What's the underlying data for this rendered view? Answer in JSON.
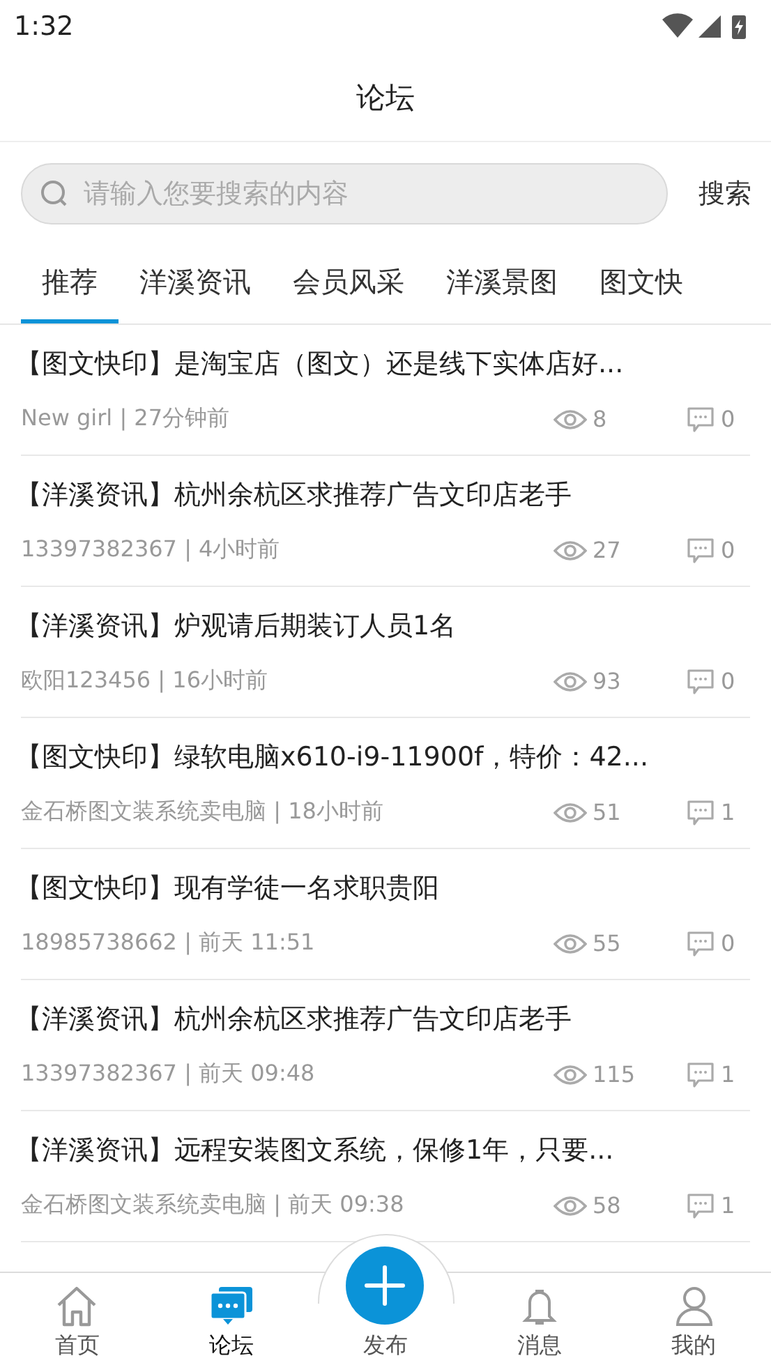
{
  "status_bar": {
    "time": "1:32"
  },
  "header": {
    "title": "论坛"
  },
  "search": {
    "placeholder": "请输入您要搜索的内容",
    "button": "搜索"
  },
  "tabs": [
    {
      "label": "推荐",
      "selected": true
    },
    {
      "label": "洋溪资讯",
      "selected": false
    },
    {
      "label": "会员风采",
      "selected": false
    },
    {
      "label": "洋溪景图",
      "selected": false
    },
    {
      "label": "图文快",
      "selected": false
    }
  ],
  "posts": [
    {
      "title": "【图文快印】是淘宝店（图文）还是线下实体店好...",
      "meta": "New girl | 27分钟前",
      "views": "8",
      "comments": "0"
    },
    {
      "title": "【洋溪资讯】杭州余杭区求推荐广告文印店老手",
      "meta": "13397382367 | 4小时前",
      "views": "27",
      "comments": "0"
    },
    {
      "title": "【洋溪资讯】炉观请后期装订人员1名",
      "meta": "欧阳123456 | 16小时前",
      "views": "93",
      "comments": "0"
    },
    {
      "title": "【图文快印】绿软电脑x610-i9-11900f，特价：42...",
      "meta": "金石桥图文装系统卖电脑 | 18小时前",
      "views": "51",
      "comments": "1"
    },
    {
      "title": "【图文快印】现有学徒一名求职贵阳",
      "meta": "18985738662 | 前天 11:51",
      "views": "55",
      "comments": "0"
    },
    {
      "title": "【洋溪资讯】杭州余杭区求推荐广告文印店老手",
      "meta": "13397382367 | 前天 09:48",
      "views": "115",
      "comments": "1"
    },
    {
      "title": "【洋溪资讯】远程安装图文系统，保修1年，只要...",
      "meta": "金石桥图文装系统卖电脑 | 前天 09:38",
      "views": "58",
      "comments": "1"
    }
  ],
  "bottom_nav": [
    {
      "kind": "home",
      "label": "首页",
      "selected": false
    },
    {
      "kind": "forum",
      "label": "论坛",
      "selected": true
    },
    {
      "kind": "publish",
      "label": "发布",
      "selected": false
    },
    {
      "kind": "bell",
      "label": "消息",
      "selected": false
    },
    {
      "kind": "user",
      "label": "我的",
      "selected": false
    }
  ]
}
